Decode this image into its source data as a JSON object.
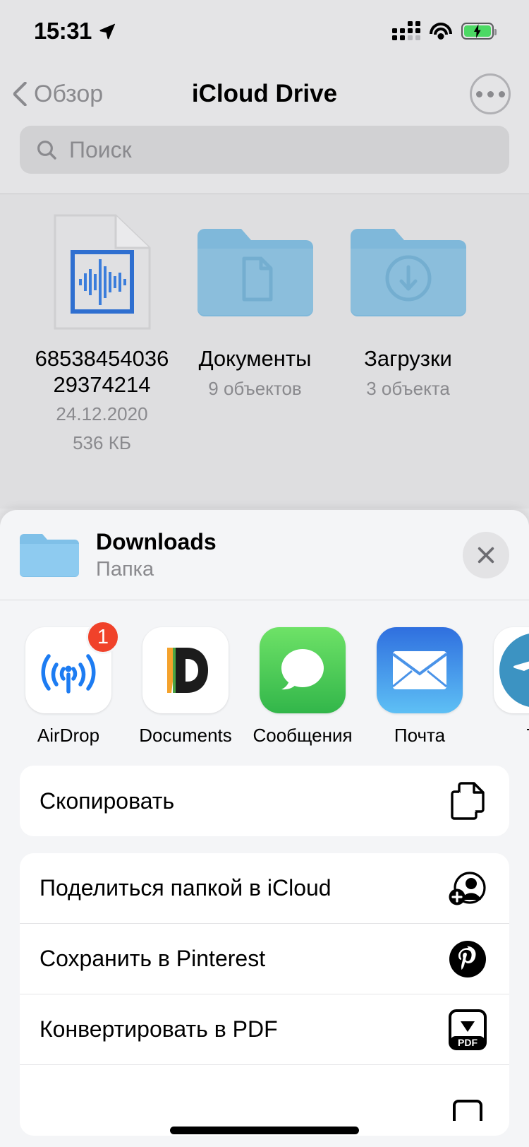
{
  "status_bar": {
    "time": "15:31",
    "location_icon": "location-arrow-icon",
    "signal_icon": "cellular-signal-icon",
    "signal_bars_active": 3,
    "signal_bars_total": 4,
    "wifi_icon": "wifi-icon",
    "battery_icon": "battery-charging-icon",
    "battery_color": "#4cd964"
  },
  "nav": {
    "back_label": "Обзор",
    "back_icon": "chevron-left-icon",
    "title": "iCloud Drive",
    "more_icon": "ellipsis-circle-icon"
  },
  "search": {
    "placeholder": "Поиск",
    "icon": "search-icon"
  },
  "files": [
    {
      "name": "6853845403629374214",
      "icon": "audio-file-icon",
      "date": "24.12.2020",
      "size": "536 КБ",
      "type": "file"
    },
    {
      "name": "Документы",
      "icon": "folder-document-icon",
      "count": "9 объектов",
      "type": "folder"
    },
    {
      "name": "Загрузки",
      "icon": "folder-download-icon",
      "count": "3 объекта",
      "type": "folder"
    }
  ],
  "share_sheet": {
    "item_title": "Downloads",
    "item_subtitle": "Папка",
    "item_icon": "folder-icon",
    "close_icon": "close-icon",
    "apps": [
      {
        "label": "AirDrop",
        "icon": "airdrop-icon",
        "badge": "1"
      },
      {
        "label": "Documents",
        "icon": "documents-app-icon"
      },
      {
        "label": "Сообщения",
        "icon": "messages-icon"
      },
      {
        "label": "Почта",
        "icon": "mail-icon"
      },
      {
        "label": "Те",
        "icon": "telegram-icon"
      }
    ],
    "actions_primary": [
      {
        "label": "Скопировать",
        "icon": "copy-icon"
      }
    ],
    "actions_secondary": [
      {
        "label": "Поделиться папкой в iCloud",
        "icon": "add-person-icon"
      },
      {
        "label": "Сохранить в Pinterest",
        "icon": "pinterest-icon"
      },
      {
        "label": "Конвертировать в PDF",
        "icon": "convert-pdf-icon"
      }
    ]
  },
  "colors": {
    "folder_blue": "#8bbedc",
    "folder_tab": "#7fb8da",
    "accent_blue": "#2f6fd0",
    "badge_red": "#f0422a",
    "battery_green": "#4cd964",
    "messages_green": "#4cd25c",
    "mail_blue": "#2e7ef0"
  }
}
